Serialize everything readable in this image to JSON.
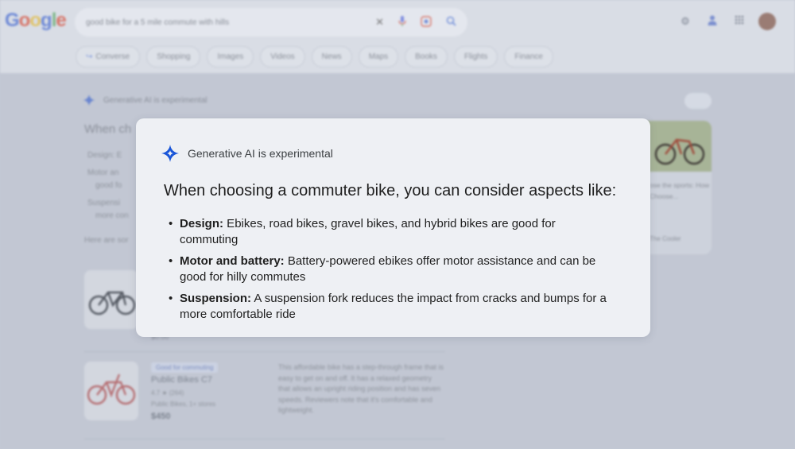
{
  "header": {
    "logo_letters": [
      "G",
      "o",
      "o",
      "g",
      "l",
      "e"
    ],
    "logo_colors": [
      "#6f8ad6",
      "#d7776b",
      "#e0c46a",
      "#6f8ad6",
      "#7fb78a",
      "#d7776b"
    ],
    "search_query": "good bike for a 5 mile commute with hills",
    "search_icons": {
      "clear": "✕",
      "mic": "🎙",
      "lens": "◎",
      "search": "⌕"
    },
    "right_icons": {
      "labs": "⚙",
      "account": "👤",
      "apps": "⋮⋮"
    }
  },
  "tabs": [
    "Converse",
    "Shopping",
    "Images",
    "Videos",
    "News",
    "Maps",
    "Books",
    "Flights",
    "Finance"
  ],
  "background": {
    "ai_label": "Generative AI is experimental",
    "heading": "When ch",
    "bullets": [
      "Design: E",
      "Motor an",
      "good fo",
      "Suspensi",
      "more con"
    ],
    "intro": "Here are sor",
    "product_top_price": "$0.00",
    "product_badge": "Good for commuting",
    "product_title": "Public Bikes C7",
    "product_rating": "4.7 ★ (264)",
    "product_stores": "Public Bikes, 1+ stores",
    "product_price": "$450",
    "product_description": "This affordable bike has a step-through frame that is easy to get on and off. It has a relaxed geometry that allows an upright riding position and has seven speeds. Reviewers note that it's comfortable and lightweight.",
    "side_card_text": "ose the sports: How Choose...",
    "side_card_source": "The Cooler"
  },
  "modal": {
    "ai_label": "Generative AI is experimental",
    "heading": "When choosing a commuter bike, you can consider aspects like:",
    "bullets": [
      {
        "term": "Design:",
        "text": " Ebikes, road bikes, gravel bikes, and hybrid bikes are good for commuting"
      },
      {
        "term": "Motor and battery:",
        "text": " Battery-powered ebikes offer motor assistance and can be good for hilly commutes"
      },
      {
        "term": "Suspension:",
        "text": " A suspension fork reduces the impact from cracks and bumps for a more comfortable ride"
      }
    ]
  },
  "colors": {
    "sparkle_blue": "#1a56d8",
    "modal_bg": "#eef0f4",
    "text_primary": "#1f1f1f"
  }
}
